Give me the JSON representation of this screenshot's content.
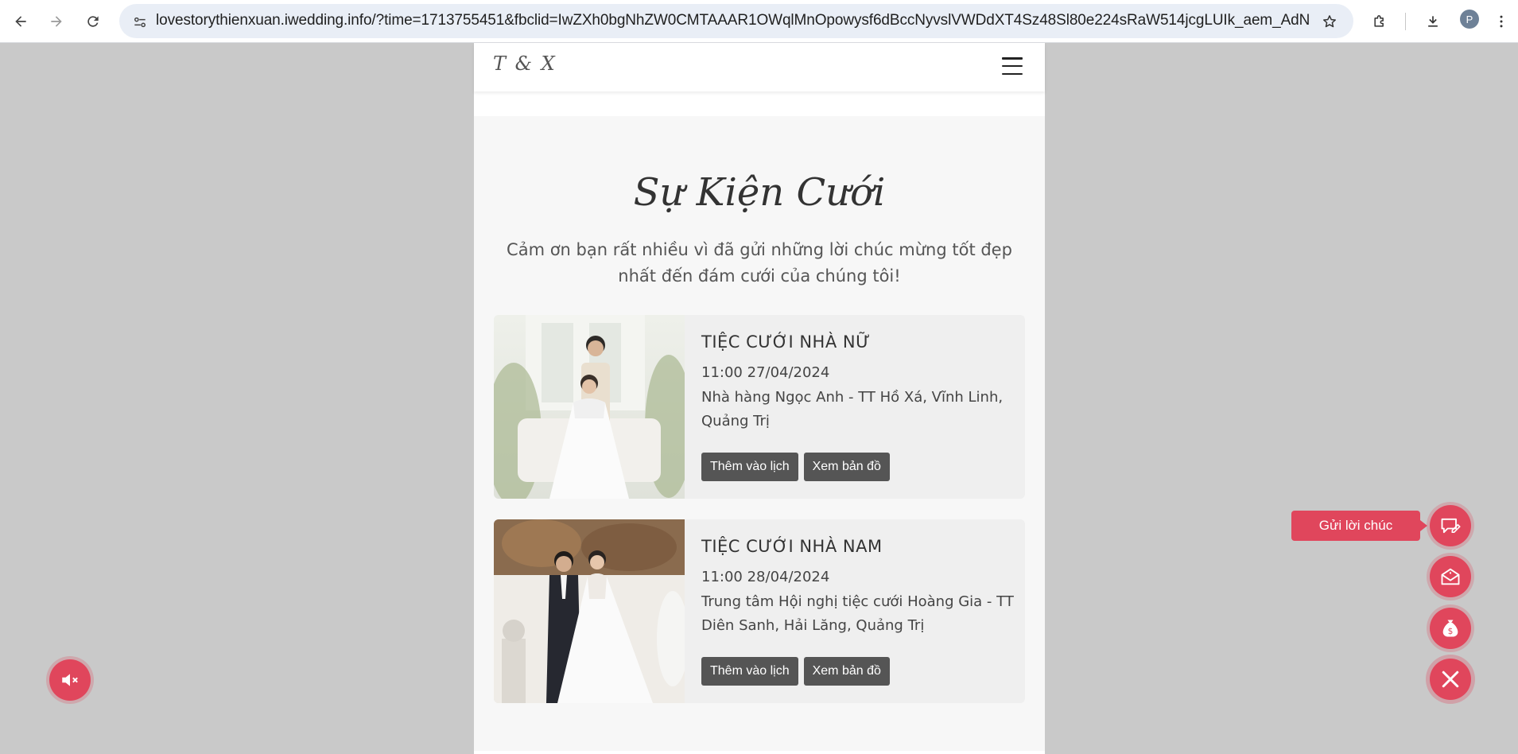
{
  "browser": {
    "url": "lovestorythienxuan.iwedding.info/?time=1713755451&fbclid=IwZXh0bgNhZW0CMTAAAR1OWqlMnOpowysf6dBccNyvslVWDdXT4Sz48Sl80e224sRaW514jcgLUIk_aem_AdNvl3seM0jkUfHs...",
    "profile_initial": "P",
    "icons": [
      "back-icon",
      "forward-icon",
      "reload-icon",
      "site-info-icon",
      "bookmark-star-icon",
      "extensions-icon",
      "download-icon",
      "profile-avatar",
      "kebab-menu-icon"
    ]
  },
  "site": {
    "logo": "T & X"
  },
  "section": {
    "title": "Sự Kiện Cưới",
    "intro": "Cảm ơn bạn rất nhiều vì đã gửi những lời chúc mừng tốt đẹp nhất đến đám cưới của chúng tôi!"
  },
  "events": [
    {
      "title": "TIỆC CƯỚI NHÀ NỮ",
      "time": "11:00 27/04/2024",
      "address": "Nhà hàng Ngọc Anh - TT Hồ Xá, Vĩnh Linh, Quảng Trị",
      "calendar_label": "Thêm vào lịch",
      "map_label": "Xem bản đồ"
    },
    {
      "title": "TIỆC CƯỚI NHÀ NAM",
      "time": "11:00 28/04/2024",
      "address": "Trung tâm Hội nghị tiệc cưới Hoàng Gia - TT Diên Sanh, Hải Lăng, Quảng Trị",
      "calendar_label": "Thêm vào lịch",
      "map_label": "Xem bản đồ"
    }
  ],
  "floating": {
    "wish_label": "Gửi lời chúc"
  },
  "colors": {
    "accent": "#e0465c",
    "button": "#555555",
    "backdrop": "#c9c9c9"
  }
}
